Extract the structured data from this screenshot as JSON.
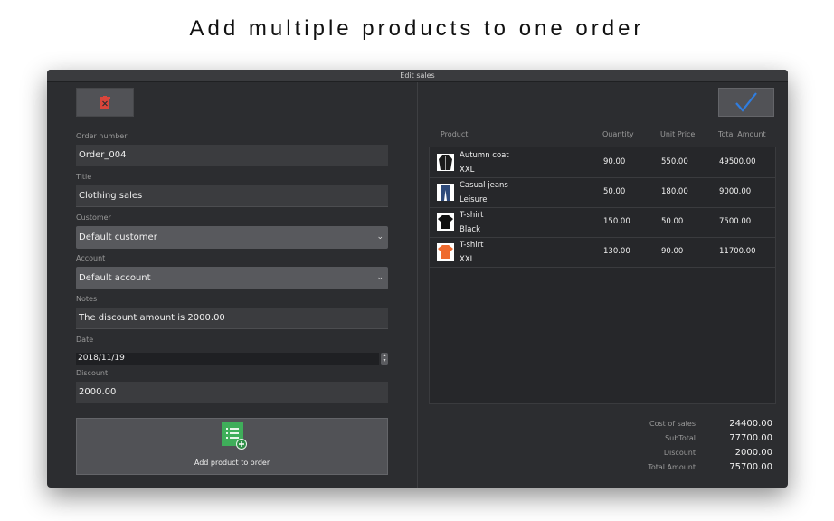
{
  "headline": "Add multiple products to one order",
  "window": {
    "title": "Edit sales"
  },
  "form": {
    "order_number_label": "Order number",
    "order_number": "Order_004",
    "title_label": "Title",
    "title": "Clothing sales",
    "customer_label": "Customer",
    "customer": "Default customer",
    "account_label": "Account",
    "account": "Default account",
    "notes_label": "Notes",
    "notes": "The discount amount is 2000.00",
    "date_label": "Date",
    "date": "2018/11/19",
    "discount_label": "Discount",
    "discount": "2000.00",
    "add_button_label": "Add product to order"
  },
  "table": {
    "headers": {
      "product": "Product",
      "quantity": "Quantity",
      "unit_price": "Unit Price",
      "total": "Total Amount"
    },
    "rows": [
      {
        "name": "Autumn coat",
        "variant": "XXL",
        "quantity": "90.00",
        "unit_price": "550.00",
        "total": "49500.00",
        "icon": "coat-icon"
      },
      {
        "name": "Casual jeans",
        "variant": "Leisure",
        "quantity": "50.00",
        "unit_price": "180.00",
        "total": "9000.00",
        "icon": "jeans-icon"
      },
      {
        "name": "T-shirt",
        "variant": "Black",
        "quantity": "150.00",
        "unit_price": "50.00",
        "total": "7500.00",
        "icon": "black-tshirt-icon"
      },
      {
        "name": "T-shirt",
        "variant": "XXL",
        "quantity": "130.00",
        "unit_price": "90.00",
        "total": "11700.00",
        "icon": "orange-tshirt-icon"
      }
    ]
  },
  "summary": {
    "cost_label": "Cost of sales",
    "cost": "24400.00",
    "subtotal_label": "SubTotal",
    "subtotal": "77700.00",
    "discount_label": "Discount",
    "discount": "2000.00",
    "total_label": "Total Amount",
    "total": "75700.00"
  },
  "colors": {
    "accent_check": "#2f7de0",
    "delete_red": "#d9453b",
    "add_green": "#3fae5a",
    "window_bg": "#2c2d30"
  }
}
